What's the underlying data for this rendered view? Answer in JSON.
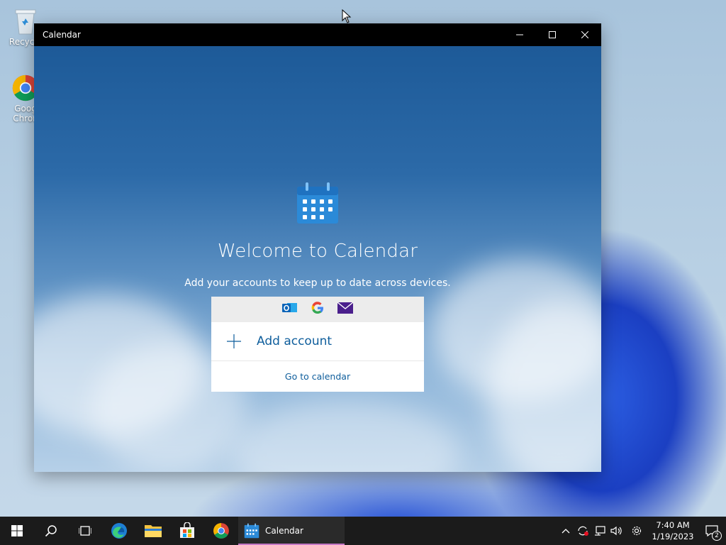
{
  "desktop": {
    "icons": [
      {
        "label": "Recycle",
        "icon": "recycle-bin-icon"
      },
      {
        "label": "Goog Chron",
        "icon": "chrome-icon"
      }
    ]
  },
  "window": {
    "title": "Calendar",
    "controls": [
      "minimize-icon",
      "maximize-icon",
      "close-icon"
    ]
  },
  "welcome": {
    "heading": "Welcome to Calendar",
    "subtitle": "Add your accounts to keep up to date across devices.",
    "providers": [
      "outlook-icon",
      "google-icon",
      "mail-icon"
    ],
    "add_account": "Add account",
    "go_to_calendar": "Go to calendar"
  },
  "taskbar": {
    "apps": [
      "start-icon",
      "search-icon",
      "task-view-icon",
      "edge-icon",
      "file-explorer-icon",
      "store-icon",
      "chrome-icon"
    ],
    "active_app": "Calendar",
    "time": "7:40 AM",
    "date": "1/19/2023",
    "notification_count": "2"
  },
  "colors": {
    "accent": "#0f5e9c",
    "titlebar": "#000000",
    "taskbar": "#1b1b1b"
  }
}
